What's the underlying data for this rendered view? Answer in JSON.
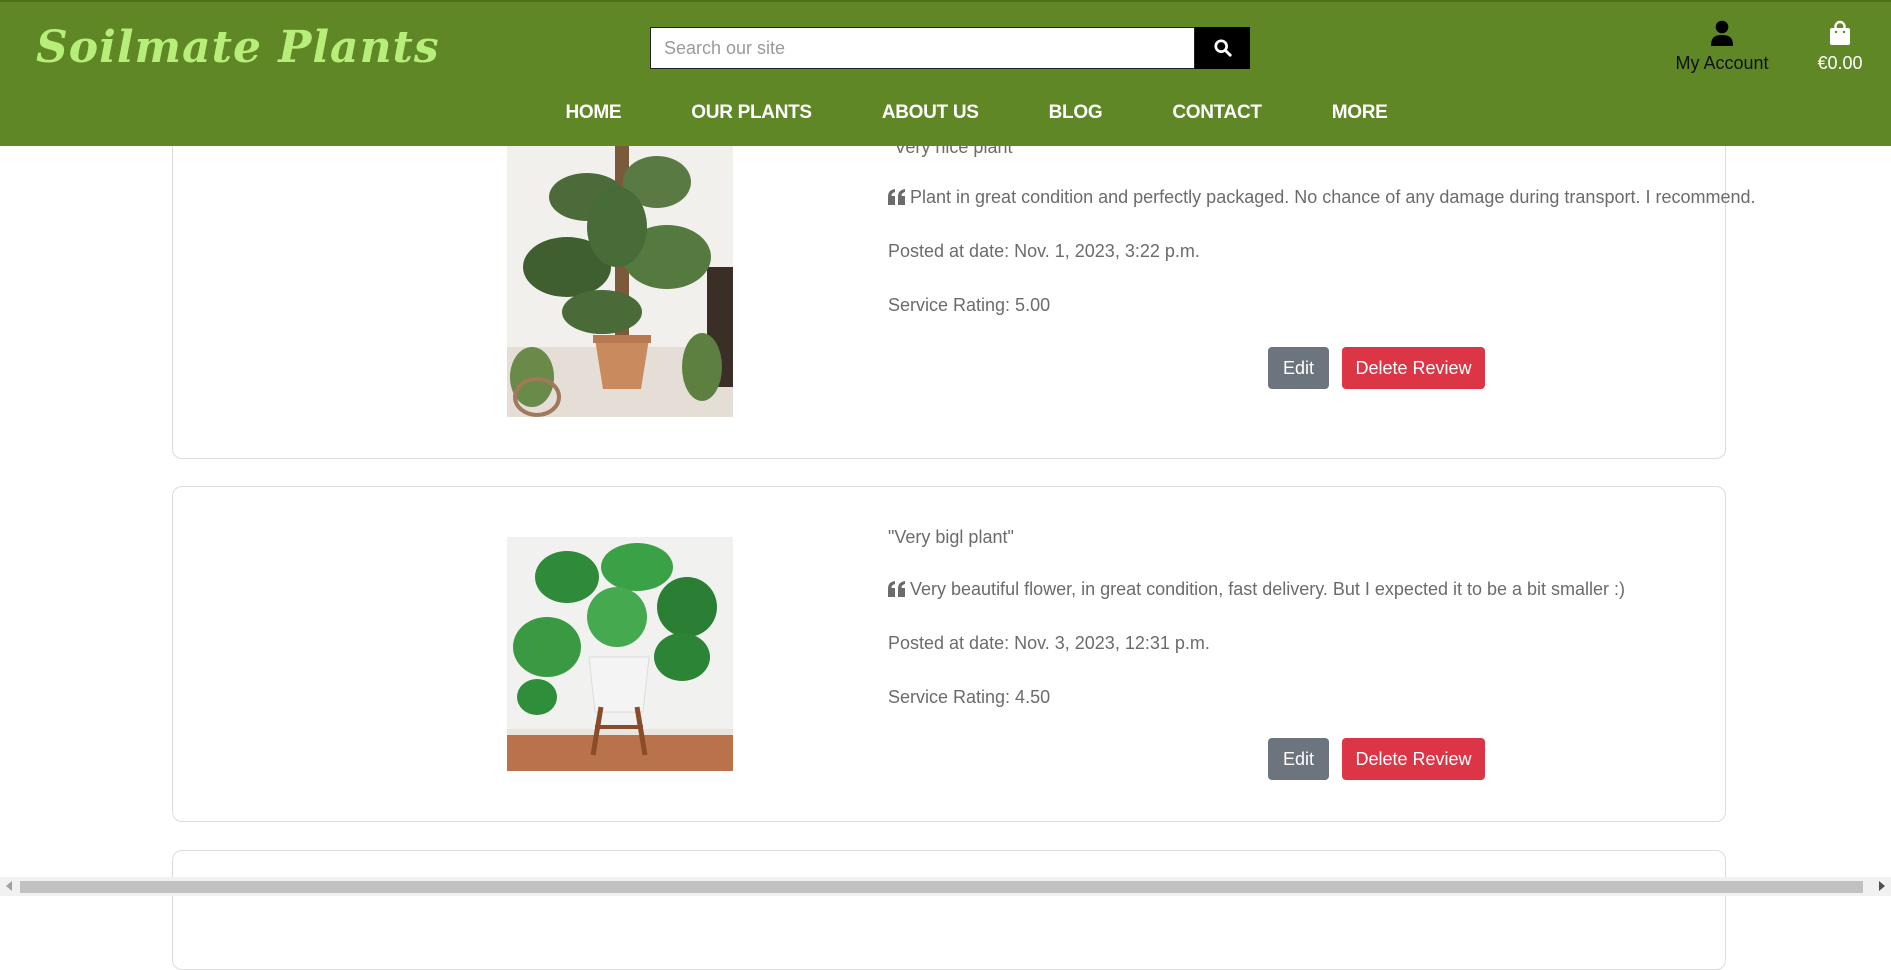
{
  "brand": {
    "logo": "Soilmate Plants"
  },
  "search": {
    "placeholder": "Search our site"
  },
  "account": {
    "label": "My Account"
  },
  "bag": {
    "total": "€0.00"
  },
  "nav": {
    "items": [
      "HOME",
      "OUR PLANTS",
      "ABOUT US",
      "BLOG",
      "CONTACT",
      "MORE"
    ]
  },
  "reviews": [
    {
      "title": "\"Very nice plant\"",
      "text": "Plant in great condition and perfectly packaged. No chance of any damage during transport. I recommend.",
      "posted": "Posted at date: Nov. 1, 2023, 3:22 p.m.",
      "rating": "Service Rating: 5.00",
      "edit_label": "Edit",
      "delete_label": "Delete Review"
    },
    {
      "title": "\"Very bigl plant\"",
      "text": "Very beautiful flower, in great condition, fast delivery. But I expected it to be a bit smaller :)",
      "posted": "Posted at date: Nov. 3, 2023, 12:31 p.m.",
      "rating": "Service Rating: 4.50",
      "edit_label": "Edit",
      "delete_label": "Delete Review"
    }
  ],
  "colors": {
    "header_bg": "#5f8725",
    "logo": "#b7ee7a",
    "edit_button": "#6c757d",
    "delete_button": "#dc3545"
  },
  "icons": {
    "search": "search-icon",
    "account": "user-icon",
    "bag": "shopping-bag-icon",
    "quote": "quote-left-icon"
  }
}
